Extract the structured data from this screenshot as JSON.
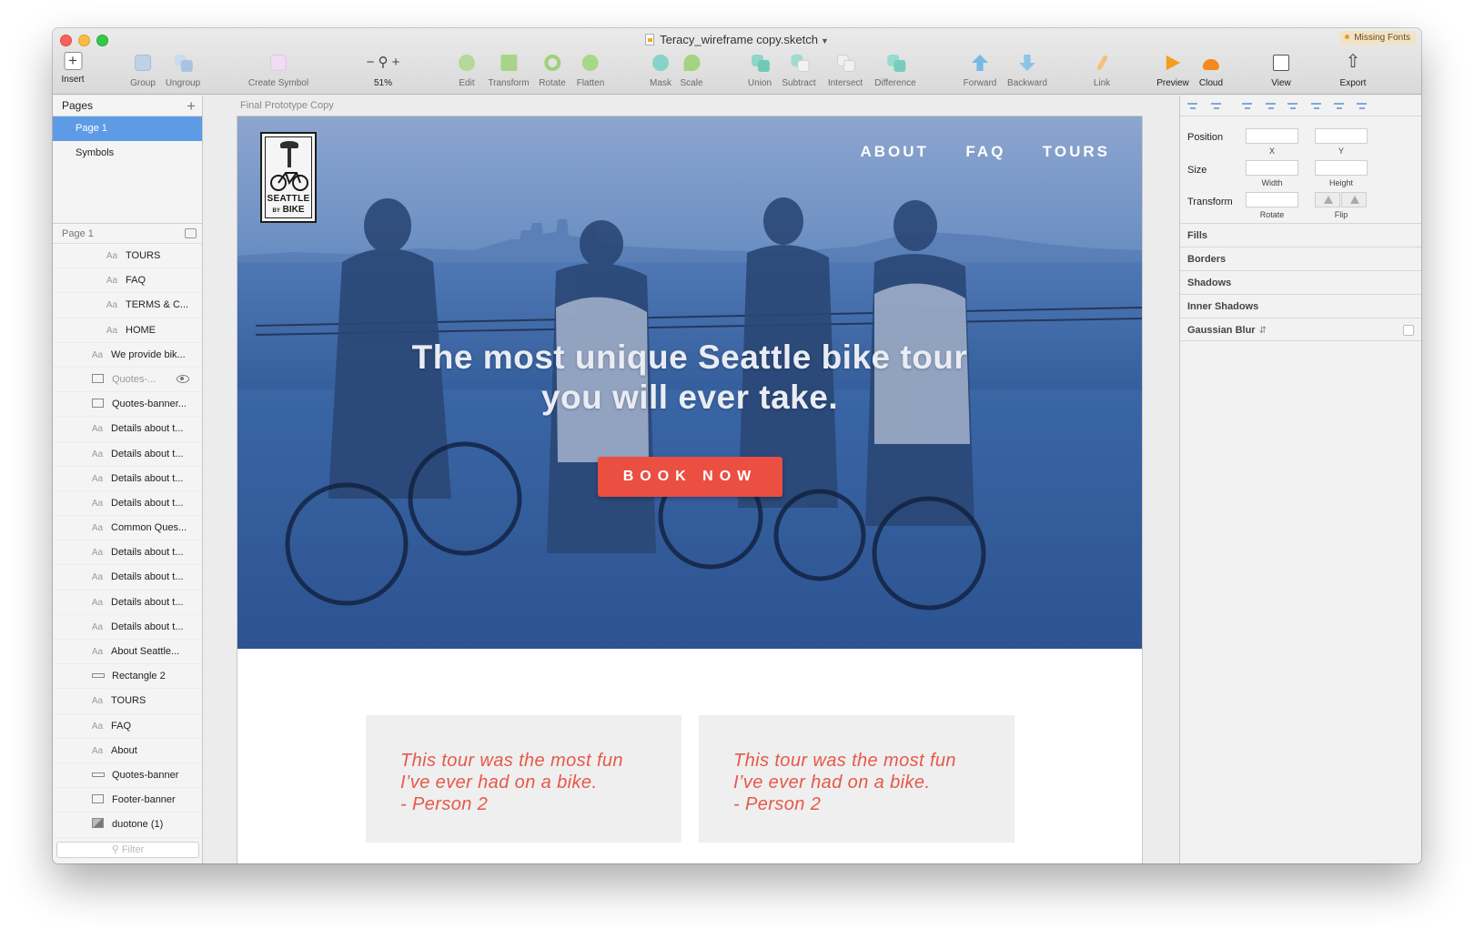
{
  "window": {
    "title": "Teracy_wireframe copy.sketch",
    "missing_fonts": "Missing Fonts"
  },
  "toolbar": {
    "insert": "Insert",
    "group": "Group",
    "ungroup": "Ungroup",
    "create_symbol": "Create Symbol",
    "zoom": "51%",
    "edit": "Edit",
    "transform": "Transform",
    "rotate": "Rotate",
    "flatten": "Flatten",
    "mask": "Mask",
    "scale": "Scale",
    "union": "Union",
    "subtract": "Subtract",
    "intersect": "Intersect",
    "difference": "Difference",
    "forward": "Forward",
    "backward": "Backward",
    "link": "Link",
    "preview": "Preview",
    "cloud": "Cloud",
    "view": "View",
    "export": "Export"
  },
  "sidebar": {
    "pages_title": "Pages",
    "pages": [
      {
        "label": "Page 1",
        "selected": true
      },
      {
        "label": "Symbols",
        "selected": false
      }
    ],
    "layers_title": "Page 1",
    "layers": [
      {
        "type": "text",
        "label": "TOURS"
      },
      {
        "type": "text",
        "label": "FAQ"
      },
      {
        "type": "text",
        "label": "TERMS & C..."
      },
      {
        "type": "text",
        "label": "HOME"
      },
      {
        "type": "text",
        "label": "We provide bik..."
      },
      {
        "type": "rect",
        "label": "Quotes-..."
      },
      {
        "type": "rect",
        "label": "Quotes-banner..."
      },
      {
        "type": "text",
        "label": "Details about t..."
      },
      {
        "type": "text",
        "label": "Details about t..."
      },
      {
        "type": "text",
        "label": "Details about t..."
      },
      {
        "type": "text",
        "label": "Details about t..."
      },
      {
        "type": "text",
        "label": "Common Ques..."
      },
      {
        "type": "text",
        "label": "Details about t..."
      },
      {
        "type": "text",
        "label": "Details about t..."
      },
      {
        "type": "text",
        "label": "Details about t..."
      },
      {
        "type": "text",
        "label": "Details about t..."
      },
      {
        "type": "text",
        "label": "About Seattle..."
      },
      {
        "type": "line",
        "label": "Rectangle 2"
      },
      {
        "type": "text",
        "label": "TOURS"
      },
      {
        "type": "text",
        "label": "FAQ"
      },
      {
        "type": "text",
        "label": "About"
      },
      {
        "type": "line",
        "label": "Quotes-banner"
      },
      {
        "type": "rect",
        "label": "Footer-banner"
      },
      {
        "type": "image",
        "label": "duotone (1)"
      }
    ],
    "filter_placeholder": "Filter"
  },
  "canvas": {
    "artboard_name": "Final Prototype Copy",
    "logo_line1": "SEATTLE",
    "logo_by": "BY",
    "logo_line2": "BIKE",
    "nav": [
      "ABOUT",
      "FAQ",
      "TOURS"
    ],
    "headline_line1": "The most unique Seattle bike tour",
    "headline_line2": "you will ever take.",
    "cta": "BOOK NOW",
    "quotes": [
      {
        "line1": "This tour was the most fun",
        "line2": "I’ve ever had on a bike.",
        "line3": "- Person 2"
      },
      {
        "line1": "This tour was the most fun",
        "line2": "I’ve ever had on a bike.",
        "line3": "- Person 2"
      }
    ]
  },
  "inspector": {
    "position": "Position",
    "x": "X",
    "y": "Y",
    "size": "Size",
    "width": "Width",
    "height": "Height",
    "transform": "Transform",
    "rotate": "Rotate",
    "flip": "Flip",
    "fills": "Fills",
    "borders": "Borders",
    "shadows": "Shadows",
    "inner_shadows": "Inner Shadows",
    "gaussian_blur": "Gaussian Blur"
  },
  "colors": {
    "hero_duotone": "#3d6aa9",
    "cta": "#ea4f41",
    "quote_text": "#e75849",
    "selection": "#5e9be6"
  }
}
